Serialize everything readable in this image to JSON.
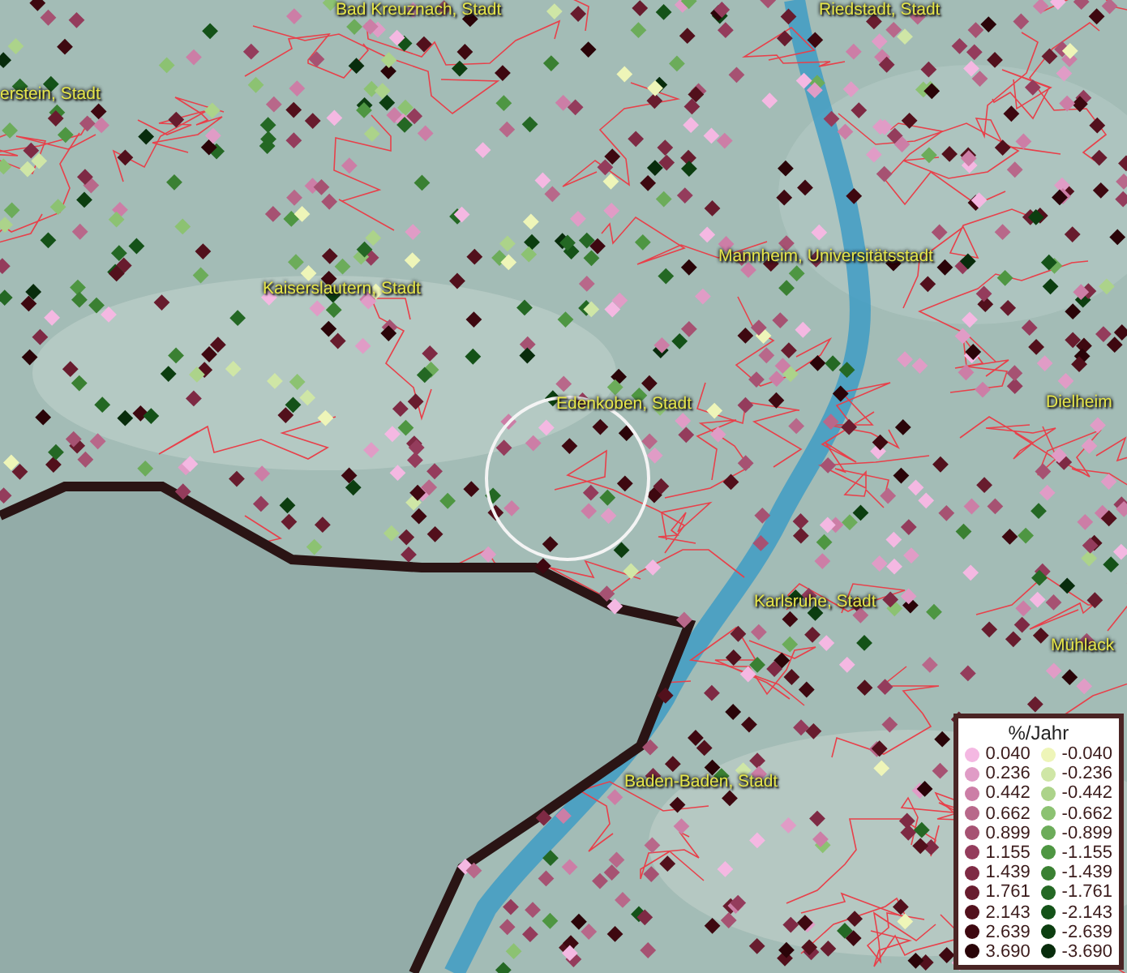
{
  "map": {
    "places": [
      {
        "label": "Bad Kreuznach, Stadt"
      },
      {
        "label": "Riedstadt, Stadt"
      },
      {
        "label": "erstein, Stadt"
      },
      {
        "label": "Kaiserslautern, Stadt"
      },
      {
        "label": "Mannheim, Universitätsstadt"
      },
      {
        "label": "Edenkoben, Stadt"
      },
      {
        "label": "Dielheim"
      },
      {
        "label": "Karlsruhe, Stadt"
      },
      {
        "label": "Mühlack"
      },
      {
        "label": "Baden-Baden, Stadt"
      }
    ]
  },
  "legend": {
    "title": "%/Jahr",
    "columns": [
      {
        "items": [
          {
            "label": "0.040",
            "color": "#f4b8e2"
          },
          {
            "label": "0.236",
            "color": "#e09cc6"
          },
          {
            "label": "0.442",
            "color": "#cc7ea6"
          },
          {
            "label": "0.662",
            "color": "#b8688a"
          },
          {
            "label": "0.899",
            "color": "#a65272"
          },
          {
            "label": "1.155",
            "color": "#943c5c"
          },
          {
            "label": "1.439",
            "color": "#7e2a44"
          },
          {
            "label": "1.761",
            "color": "#681c2e"
          },
          {
            "label": "2.143",
            "color": "#52101c"
          },
          {
            "label": "2.639",
            "color": "#3e0810"
          },
          {
            "label": "3.690",
            "color": "#2a0408"
          }
        ]
      },
      {
        "items": [
          {
            "label": "-0.040",
            "color": "#eef5b8"
          },
          {
            "label": "-0.236",
            "color": "#cfe6a6"
          },
          {
            "label": "-0.442",
            "color": "#acd38a"
          },
          {
            "label": "-0.662",
            "color": "#8cc272"
          },
          {
            "label": "-0.899",
            "color": "#6cac5a"
          },
          {
            "label": "-1.155",
            "color": "#4e9642"
          },
          {
            "label": "-1.439",
            "color": "#3a8032"
          },
          {
            "label": "-1.761",
            "color": "#246824"
          },
          {
            "label": "-2.143",
            "color": "#145218"
          },
          {
            "label": "-2.639",
            "color": "#0c3e10"
          },
          {
            "label": "-3.690",
            "color": "#082c0c"
          }
        ]
      }
    ]
  }
}
